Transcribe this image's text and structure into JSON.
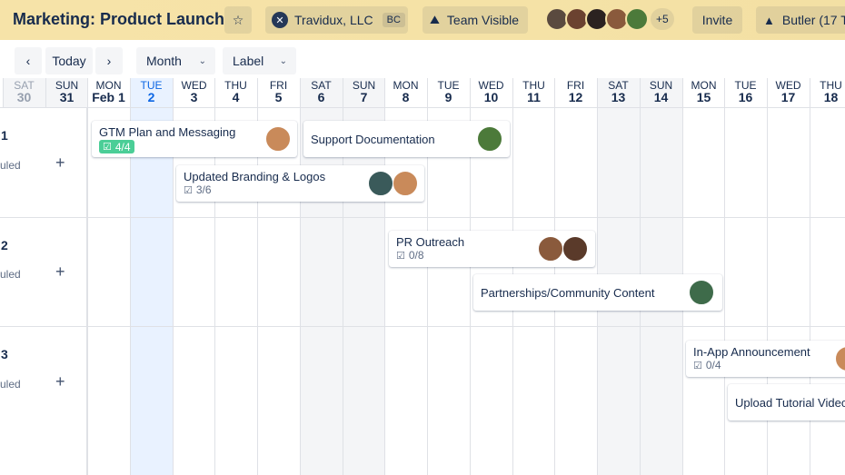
{
  "header": {
    "board_title": "Marketing: Product Launch",
    "workspace_name": "Travidux, LLC",
    "workspace_badge": "BC",
    "visibility_label": "Team Visible",
    "members_more": "+5",
    "invite_label": "Invite",
    "butler_label": "Butler (17 T"
  },
  "toolbar": {
    "today_label": "Today",
    "view_label": "Month",
    "group_label": "Label"
  },
  "days": [
    {
      "dow": "SAT",
      "num": "30"
    },
    {
      "dow": "SUN",
      "num": "31"
    },
    {
      "dow": "MON",
      "num": "Feb 1"
    },
    {
      "dow": "TUE",
      "num": "2"
    },
    {
      "dow": "WED",
      "num": "3"
    },
    {
      "dow": "THU",
      "num": "4"
    },
    {
      "dow": "FRI",
      "num": "5"
    },
    {
      "dow": "SAT",
      "num": "6"
    },
    {
      "dow": "SUN",
      "num": "7"
    },
    {
      "dow": "MON",
      "num": "8"
    },
    {
      "dow": "TUE",
      "num": "9"
    },
    {
      "dow": "WED",
      "num": "10"
    },
    {
      "dow": "THU",
      "num": "11"
    },
    {
      "dow": "FRI",
      "num": "12"
    },
    {
      "dow": "SAT",
      "num": "13"
    },
    {
      "dow": "SUN",
      "num": "14"
    },
    {
      "dow": "MON",
      "num": "15"
    },
    {
      "dow": "TUE",
      "num": "16"
    },
    {
      "dow": "WED",
      "num": "17"
    },
    {
      "dow": "THU",
      "num": "18"
    }
  ],
  "rows": [
    {
      "num": "1",
      "sub": "uled"
    },
    {
      "num": "2",
      "sub": "uled"
    },
    {
      "num": "3",
      "sub": "uled"
    }
  ],
  "cards": [
    {
      "title": "GTM Plan and Messaging",
      "checklist": "4/4"
    },
    {
      "title": "Support Documentation"
    },
    {
      "title": "Updated Branding & Logos",
      "checklist": "3/6"
    },
    {
      "title": "PR Outreach",
      "checklist": "0/8"
    },
    {
      "title": "Partnerships/Community Content"
    },
    {
      "title": "In-App Announcement",
      "checklist": "0/4"
    },
    {
      "title": "Upload Tutorial Video"
    }
  ],
  "colors": {
    "header_bg": "#f5e2a6",
    "today_blue": "#0c66e4",
    "checklist_done": "#4bce97",
    "weekend_bg": "#f4f5f7",
    "today_bg": "#e9f2ff"
  },
  "icons": {
    "star": "star-icon",
    "visibility": "team-visible-icon",
    "butler": "butler-icon",
    "prev": "chevron-left-icon",
    "next": "chevron-right-icon",
    "checklist": "checklist-icon"
  }
}
